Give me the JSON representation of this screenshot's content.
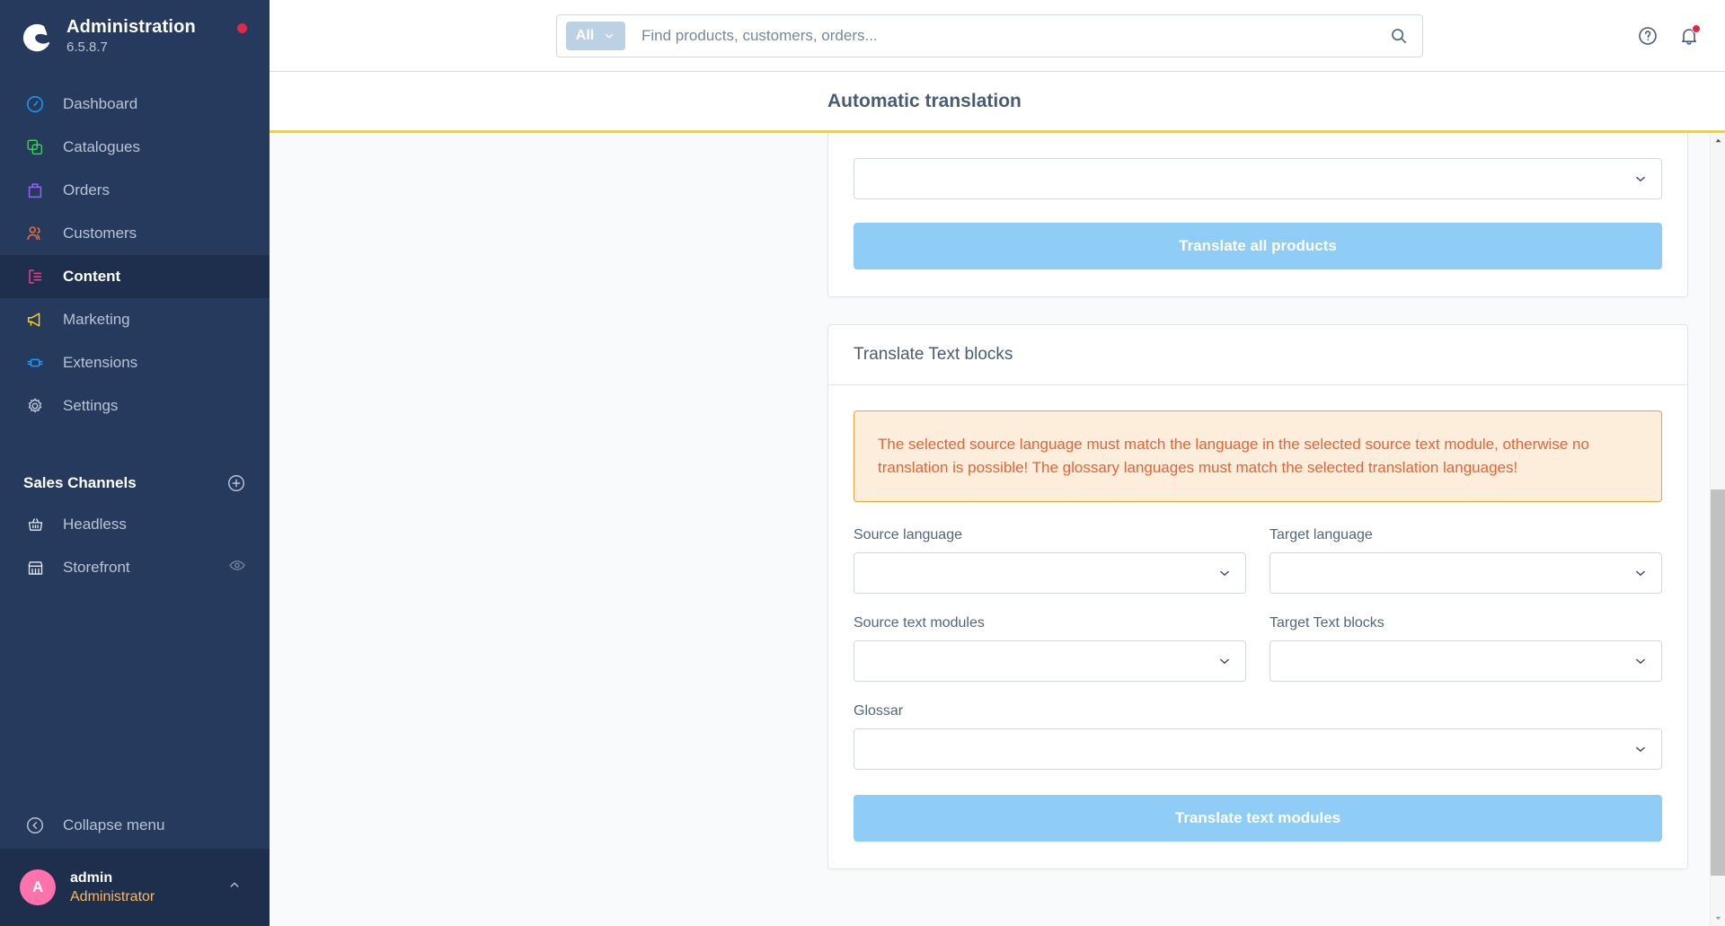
{
  "sidebar": {
    "brand": {
      "title": "Administration",
      "version": "6.5.8.7",
      "logo_icon": "shopware-logo-icon",
      "notification_dot": true
    },
    "nav_items": [
      {
        "label": "Dashboard",
        "icon": "dashboard-icon",
        "color": "#189eff",
        "active": false
      },
      {
        "label": "Catalogues",
        "icon": "catalogues-icon",
        "color": "#37d046",
        "active": false
      },
      {
        "label": "Orders",
        "icon": "orders-icon",
        "color": "#9c5fff",
        "active": false
      },
      {
        "label": "Customers",
        "icon": "customers-icon",
        "color": "#ff6b35",
        "active": false
      },
      {
        "label": "Content",
        "icon": "content-icon",
        "color": "#ff3a8b",
        "active": true
      },
      {
        "label": "Marketing",
        "icon": "marketing-icon",
        "color": "#ffd700",
        "active": false
      },
      {
        "label": "Extensions",
        "icon": "extensions-icon",
        "color": "#189eff",
        "active": false
      },
      {
        "label": "Settings",
        "icon": "settings-icon",
        "color": "#b8c4d6",
        "active": false
      }
    ],
    "section": {
      "title": "Sales Channels",
      "add_icon": "plus-circle-icon"
    },
    "channels": [
      {
        "label": "Headless",
        "icon": "basket-icon",
        "trailing_icon": ""
      },
      {
        "label": "Storefront",
        "icon": "storefront-icon",
        "trailing_icon": "eye-icon"
      }
    ],
    "collapse": {
      "label": "Collapse menu",
      "icon": "collapse-left-icon"
    },
    "user": {
      "initial": "A",
      "name": "admin",
      "role": "Administrator",
      "caret_icon": "chevron-up-icon"
    }
  },
  "topbar": {
    "search": {
      "scope_label": "All",
      "scope_caret_icon": "chevron-down-icon",
      "placeholder": "Find products, customers, orders...",
      "value": "",
      "search_icon": "search-icon"
    },
    "help_icon": "question-circle-icon",
    "notifications_icon": "bell-icon",
    "notifications_unread": true
  },
  "page": {
    "title": "Automatic translation",
    "accent_color": "#ffd700"
  },
  "cards": [
    {
      "name": "translate-all-products-card",
      "title": "",
      "select": {
        "label": "",
        "value": "",
        "caret_icon": "chevron-down-icon"
      },
      "button": {
        "label": "Translate all products"
      }
    },
    {
      "name": "translate-text-blocks-card",
      "title": "Translate Text blocks",
      "alert": {
        "text": "The selected source language must match the language in the selected source text module, otherwise no translation is possible! The glossary languages must match the selected translation languages!"
      },
      "fields": [
        {
          "label": "Source language",
          "value": "",
          "caret_icon": "chevron-down-icon"
        },
        {
          "label": "Target language",
          "value": "",
          "caret_icon": "chevron-down-icon"
        },
        {
          "label": "Source text modules",
          "value": "",
          "caret_icon": "chevron-down-icon"
        },
        {
          "label": "Target Text blocks",
          "value": "",
          "caret_icon": "chevron-down-icon"
        },
        {
          "label": "Glossar",
          "value": "",
          "caret_icon": "chevron-down-icon"
        }
      ],
      "button": {
        "label": "Translate text modules"
      }
    }
  ],
  "scrollbar": {
    "up_icon": "caret-up-icon",
    "down_icon": "caret-down-icon"
  }
}
